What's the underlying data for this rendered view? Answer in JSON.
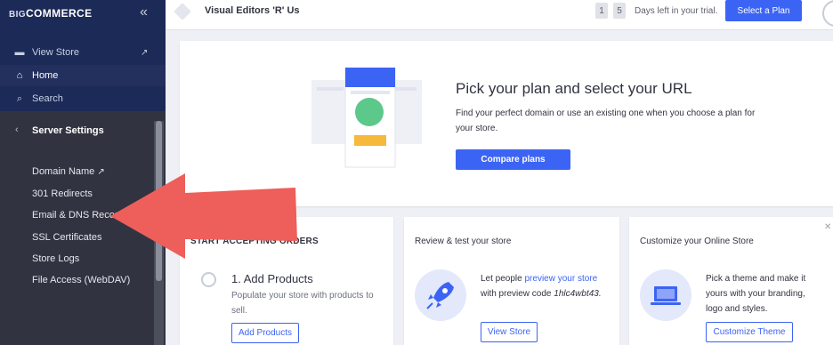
{
  "brand": {
    "prefix": "BIG",
    "name": "COMMERCE",
    "collapse_glyph": "«"
  },
  "sidebar": {
    "top_items": [
      {
        "label": "View Store",
        "icon": "store-icon"
      },
      {
        "label": "Home",
        "icon": "home-icon"
      },
      {
        "label": "Search",
        "icon": "search-icon"
      }
    ],
    "section": {
      "back_glyph": "‹",
      "title": "Server Settings"
    },
    "sub_items": [
      {
        "label": "Domain Name"
      },
      {
        "label": "301 Redirects"
      },
      {
        "label": "Email & DNS Records"
      },
      {
        "label": "SSL Certificates"
      },
      {
        "label": "Store Logs"
      },
      {
        "label": "File Access (WebDAV)"
      }
    ]
  },
  "topbar": {
    "store_name": "Visual Editors 'R' Us",
    "trial_digits": [
      "1",
      "5"
    ],
    "trial_text": "Days left in your trial.",
    "select_plan": "Select a Plan"
  },
  "hero": {
    "title": "Pick your plan and select your URL",
    "description": "Find your perfect domain or use an existing one when you choose a plan for your store.",
    "button": "Compare plans"
  },
  "cards": [
    {
      "title": "START ACCEPTING ORDERS",
      "step_title": "1. Add Products",
      "step_desc": "Populate your store with products to sell.",
      "button": "Add Products"
    },
    {
      "title": "Review & test your store",
      "text_pre": "Let people ",
      "text_link": "preview your store",
      "text_mid": " with preview code ",
      "text_code": "1hlc4wbt43.",
      "button": "View Store"
    },
    {
      "title": "Customize your Online Store",
      "text": "Pick a theme and make it yours with your branding, logo and styles.",
      "button": "Customize Theme"
    }
  ],
  "colors": {
    "sidebar_dark": "#313440",
    "sidebar_top": "#1c2a57",
    "primary": "#3c64f4",
    "arrow": "#ee5e5a"
  }
}
